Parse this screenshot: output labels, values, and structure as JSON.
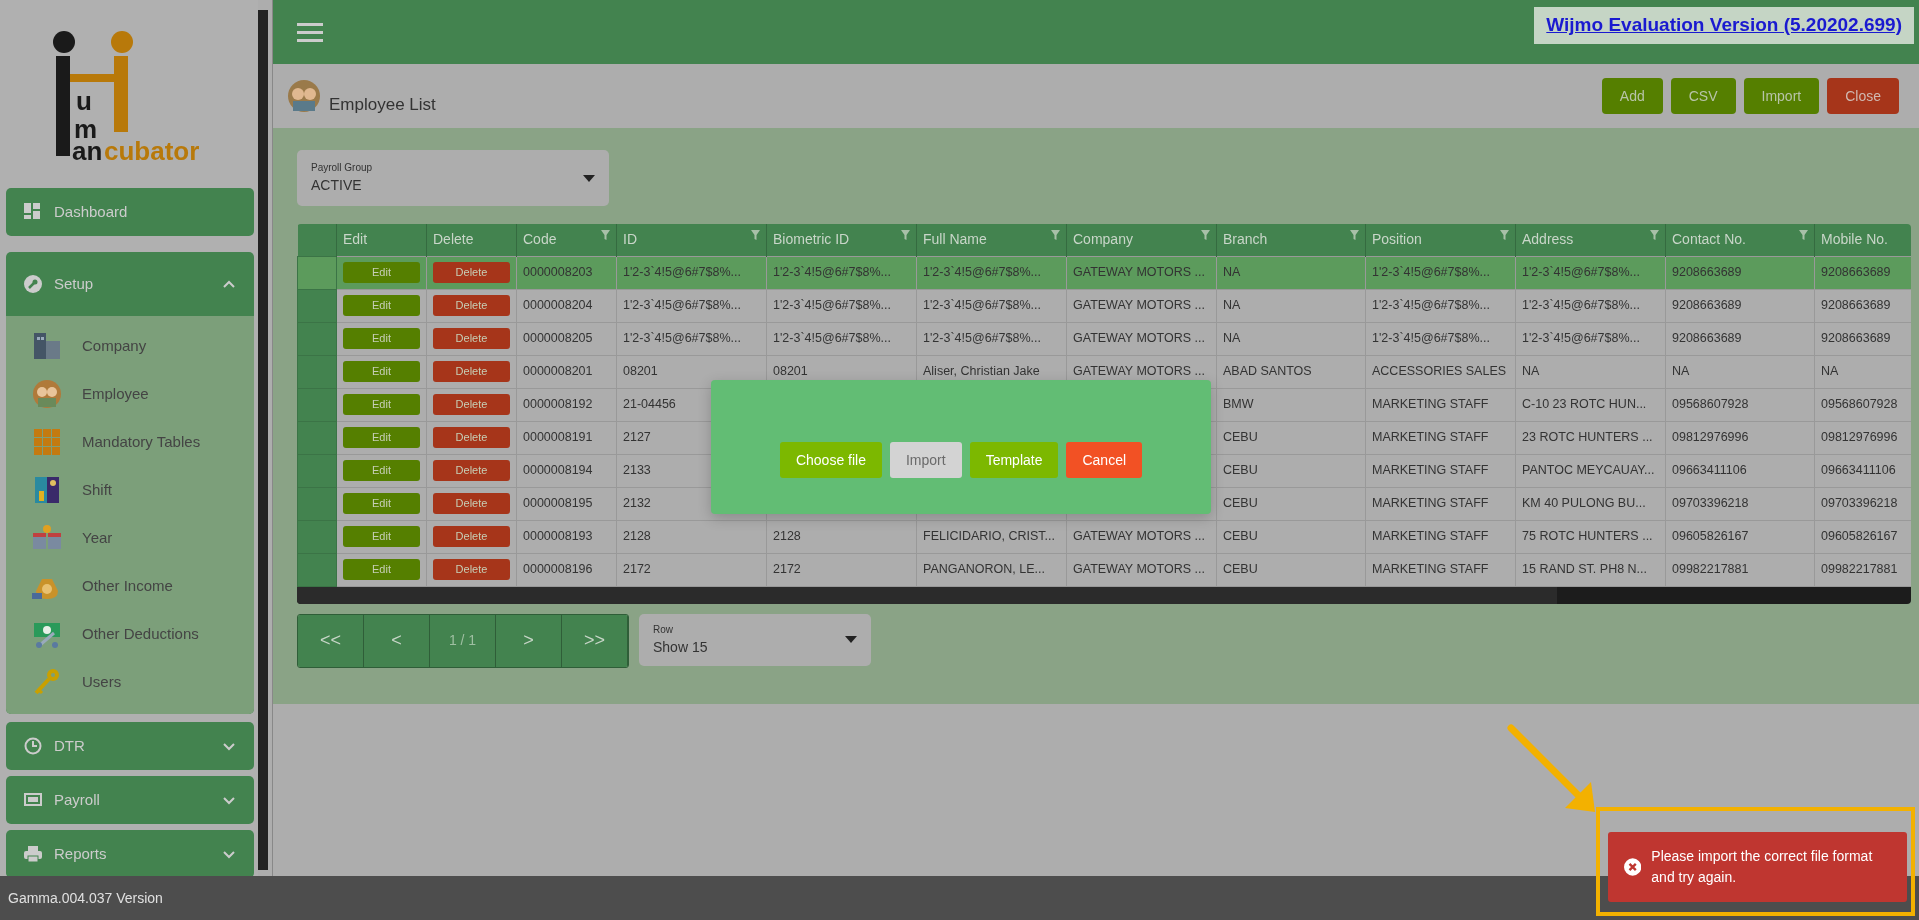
{
  "header": {
    "notice": "Wijmo Evaluation Version (5.20202.699)"
  },
  "sidebar": {
    "logo": {
      "letters": [
        "u",
        "m"
      ],
      "dark": "an",
      "accent": "cubator"
    },
    "groups": [
      {
        "label": "Dashboard"
      },
      {
        "label": "Setup",
        "expanded": true,
        "items": [
          "Company",
          "Employee",
          "Mandatory Tables",
          "Shift",
          "Year",
          "Other Income",
          "Other Deductions",
          "Users"
        ]
      },
      {
        "label": "DTR",
        "expanded": false
      },
      {
        "label": "Payroll",
        "expanded": false
      },
      {
        "label": "Reports",
        "expanded": false
      }
    ]
  },
  "page": {
    "title": "Employee List",
    "actions": [
      {
        "label": "Add",
        "kind": "primary"
      },
      {
        "label": "CSV",
        "kind": "primary"
      },
      {
        "label": "Import",
        "kind": "primary"
      },
      {
        "label": "Close",
        "kind": "danger"
      }
    ]
  },
  "payroll_group": {
    "label": "Payroll Group",
    "value": "ACTIVE"
  },
  "table": {
    "columns": [
      {
        "label": "Edit",
        "filter": false,
        "kind": "edit"
      },
      {
        "label": "Delete",
        "filter": false,
        "kind": "delete"
      },
      {
        "label": "Code",
        "filter": true,
        "kind": "text"
      },
      {
        "label": "ID",
        "filter": true,
        "kind": "text"
      },
      {
        "label": "Biometric ID",
        "filter": true,
        "kind": "text"
      },
      {
        "label": "Full Name",
        "filter": true,
        "kind": "text"
      },
      {
        "label": "Company",
        "filter": true,
        "kind": "text"
      },
      {
        "label": "Branch",
        "filter": true,
        "kind": "text"
      },
      {
        "label": "Position",
        "filter": true,
        "kind": "text"
      },
      {
        "label": "Address",
        "filter": true,
        "kind": "text"
      },
      {
        "label": "Contact No.",
        "filter": true,
        "kind": "text"
      },
      {
        "label": "Mobile No.",
        "filter": false,
        "kind": "text"
      }
    ],
    "rows": [
      {
        "selected": true,
        "cells": [
          "Edit",
          "Delete",
          "0000008203",
          "1'2-3`4!5@6#7$8%...",
          "1'2-3`4!5@6#7$8%...",
          "1'2-3`4!5@6#7$8%...",
          "GATEWAY MOTORS ...",
          "NA",
          "1'2-3`4!5@6#7$8%...",
          "1'2-3`4!5@6#7$8%...",
          "9208663689",
          "9208663689"
        ]
      },
      {
        "selected": false,
        "cells": [
          "Edit",
          "Delete",
          "0000008204",
          "1'2-3`4!5@6#7$8%...",
          "1'2-3`4!5@6#7$8%...",
          "1'2-3`4!5@6#7$8%...",
          "GATEWAY MOTORS ...",
          "NA",
          "1'2-3`4!5@6#7$8%...",
          "1'2-3`4!5@6#7$8%...",
          "9208663689",
          "9208663689"
        ]
      },
      {
        "selected": false,
        "cells": [
          "Edit",
          "Delete",
          "0000008205",
          "1'2-3`4!5@6#7$8%...",
          "1'2-3`4!5@6#7$8%...",
          "1'2-3`4!5@6#7$8%...",
          "GATEWAY MOTORS ...",
          "NA",
          "1'2-3`4!5@6#7$8%...",
          "1'2-3`4!5@6#7$8%...",
          "9208663689",
          "9208663689"
        ]
      },
      {
        "selected": false,
        "cells": [
          "Edit",
          "Delete",
          "0000008201",
          "08201",
          "08201",
          "Aliser, Christian Jake",
          "GATEWAY MOTORS ...",
          "ABAD SANTOS",
          "ACCESSORIES SALES",
          "NA",
          "NA",
          "NA"
        ]
      },
      {
        "selected": false,
        "cells": [
          "Edit",
          "Delete",
          "0000008192",
          "21-04456",
          null,
          null,
          null,
          "BMW",
          "MARKETING STAFF",
          "C-10 23 ROTC HUN...",
          "09568607928",
          "09568607928"
        ]
      },
      {
        "selected": false,
        "cells": [
          "Edit",
          "Delete",
          "0000008191",
          "2127",
          null,
          null,
          null,
          "CEBU",
          "MARKETING STAFF",
          "23 ROTC HUNTERS ...",
          "09812976996",
          "09812976996"
        ]
      },
      {
        "selected": false,
        "cells": [
          "Edit",
          "Delete",
          "0000008194",
          "2133",
          null,
          null,
          null,
          "CEBU",
          "MARKETING STAFF",
          "PANTOC MEYCAUAY...",
          "09663411106",
          "09663411106"
        ]
      },
      {
        "selected": false,
        "cells": [
          "Edit",
          "Delete",
          "0000008195",
          "2132",
          null,
          null,
          null,
          "CEBU",
          "MARKETING STAFF",
          "KM 40 PULONG BU...",
          "09703396218",
          "09703396218"
        ]
      },
      {
        "selected": false,
        "cells": [
          "Edit",
          "Delete",
          "0000008193",
          "2128",
          "2128",
          "FELICIDARIO, CRIST...",
          "GATEWAY MOTORS ...",
          "CEBU",
          "MARKETING STAFF",
          "75 ROTC HUNTERS ...",
          "09605826167",
          "09605826167"
        ]
      },
      {
        "selected": false,
        "cells": [
          "Edit",
          "Delete",
          "0000008196",
          "2172",
          "2172",
          "PANGANORON, LE...",
          "GATEWAY MOTORS ...",
          "CEBU",
          "MARKETING STAFF",
          "15 RAND ST. PH8 N...",
          "09982217881",
          "09982217881"
        ]
      }
    ]
  },
  "pager": [
    {
      "label": "<<",
      "kind": "button"
    },
    {
      "label": "<",
      "kind": "button"
    },
    {
      "label": "1 / 1",
      "kind": "status"
    },
    {
      "label": ">",
      "kind": "button"
    },
    {
      "label": ">>",
      "kind": "button"
    }
  ],
  "row_select": {
    "label": "Row",
    "value": "Show 15"
  },
  "import_dialog": {
    "buttons": [
      {
        "label": "Choose file",
        "kind": "primary",
        "disabled": false
      },
      {
        "label": "Import",
        "kind": "primary",
        "disabled": true
      },
      {
        "label": "Template",
        "kind": "primary",
        "disabled": false
      },
      {
        "label": "Cancel",
        "kind": "danger",
        "disabled": false
      }
    ]
  },
  "toast": {
    "message": "Please import the correct file format and try again."
  },
  "footer": {
    "version": "Gamma.004.037 Version"
  }
}
